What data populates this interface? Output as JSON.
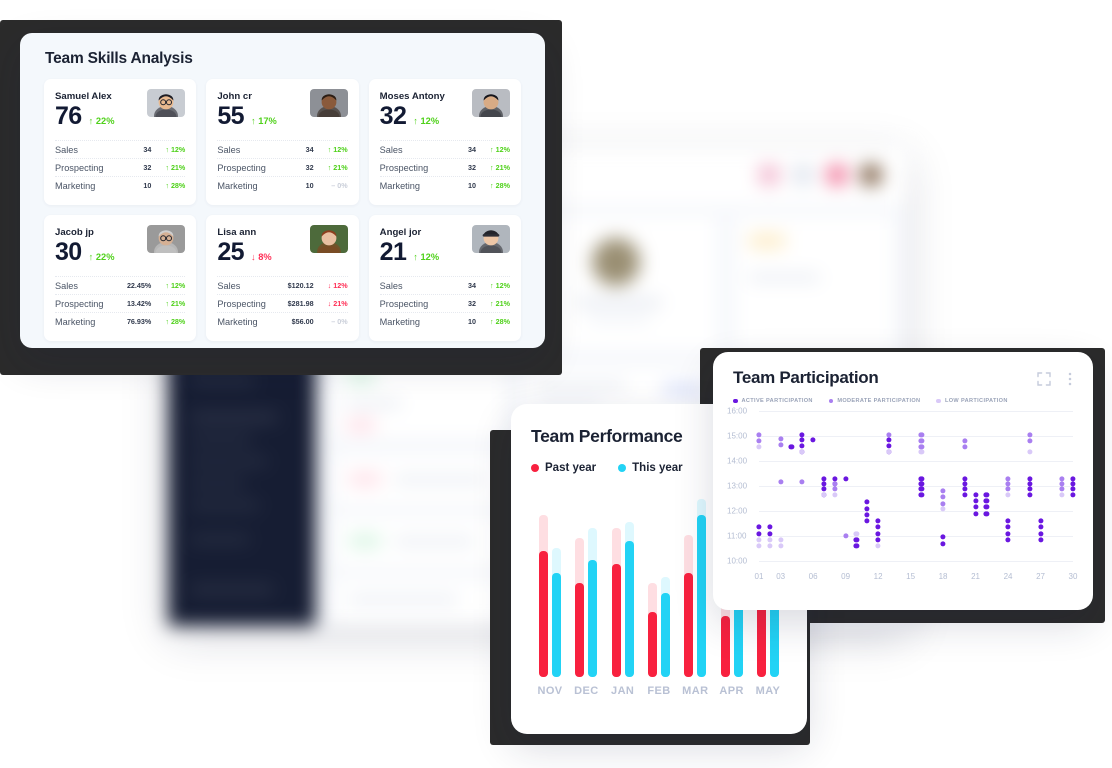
{
  "colors": {
    "frame": "#2b2b2b",
    "up": "#4fd11a",
    "down": "#ff2e55",
    "flat": "#c9ced9",
    "past_year": "#f8213f",
    "this_year": "#22d3f5",
    "active": "#6a17e0",
    "moderate": "#a97ff0",
    "low": "#d9c9f8",
    "panel_bg": "#f4f8fc"
  },
  "skills": {
    "title": "Team Skills Analysis",
    "metric_labels": [
      "Sales",
      "Prospecting",
      "Marketing"
    ],
    "cards": [
      {
        "name": "Samuel Alex",
        "score": "76",
        "delta": "22%",
        "dir": "up",
        "rows": [
          {
            "label": "Sales",
            "value": "34",
            "pct": "12%",
            "dir": "up"
          },
          {
            "label": "Prospecting",
            "value": "32",
            "pct": "21%",
            "dir": "up"
          },
          {
            "label": "Marketing",
            "value": "10",
            "pct": "28%",
            "dir": "up"
          }
        ]
      },
      {
        "name": "John cr",
        "score": "55",
        "delta": "17%",
        "dir": "up",
        "rows": [
          {
            "label": "Sales",
            "value": "34",
            "pct": "12%",
            "dir": "up"
          },
          {
            "label": "Prospecting",
            "value": "32",
            "pct": "21%",
            "dir": "up"
          },
          {
            "label": "Marketing",
            "value": "10",
            "pct": "0%",
            "dir": "flat"
          }
        ]
      },
      {
        "name": "Moses Antony",
        "score": "32",
        "delta": "12%",
        "dir": "up",
        "rows": [
          {
            "label": "Sales",
            "value": "34",
            "pct": "12%",
            "dir": "up"
          },
          {
            "label": "Prospecting",
            "value": "32",
            "pct": "21%",
            "dir": "up"
          },
          {
            "label": "Marketing",
            "value": "10",
            "pct": "28%",
            "dir": "up"
          }
        ]
      },
      {
        "name": "Jacob jp",
        "score": "30",
        "delta": "22%",
        "dir": "up",
        "rows": [
          {
            "label": "Sales",
            "value": "22.45%",
            "pct": "12%",
            "dir": "up"
          },
          {
            "label": "Prospecting",
            "value": "13.42%",
            "pct": "21%",
            "dir": "up"
          },
          {
            "label": "Marketing",
            "value": "76.93%",
            "pct": "28%",
            "dir": "up"
          }
        ]
      },
      {
        "name": "Lisa ann",
        "score": "25",
        "delta": "8%",
        "dir": "down",
        "rows": [
          {
            "label": "Sales",
            "value": "$120.12",
            "pct": "12%",
            "dir": "down"
          },
          {
            "label": "Prospecting",
            "value": "$281.98",
            "pct": "21%",
            "dir": "down"
          },
          {
            "label": "Marketing",
            "value": "$56.00",
            "pct": "0%",
            "dir": "flat"
          }
        ]
      },
      {
        "name": "Angel jor",
        "score": "21",
        "delta": "12%",
        "dir": "up",
        "rows": [
          {
            "label": "Sales",
            "value": "34",
            "pct": "12%",
            "dir": "up"
          },
          {
            "label": "Prospecting",
            "value": "32",
            "pct": "21%",
            "dir": "up"
          },
          {
            "label": "Marketing",
            "value": "10",
            "pct": "28%",
            "dir": "up"
          }
        ]
      }
    ]
  },
  "performance": {
    "title": "Team Performance",
    "legend": [
      {
        "label": "Past year",
        "color": "#f8213f"
      },
      {
        "label": "This year",
        "color": "#22d3f5"
      }
    ]
  },
  "participation": {
    "title": "Team Participation",
    "icons": [
      "expand-icon",
      "more-vertical-icon"
    ],
    "legend": [
      {
        "label": "ACTIVE PARTICIPATION",
        "color": "#6a17e0"
      },
      {
        "label": "MODERATE PARTICIPATION",
        "color": "#a97ff0"
      },
      {
        "label": "LOW PARTICIPATION",
        "color": "#d9c9f8"
      }
    ]
  },
  "chart_data": [
    {
      "type": "bar",
      "title": "Team Performance",
      "categories": [
        "NOV",
        "DEC",
        "JAN",
        "FEB",
        "MAR",
        "APR",
        "MAY"
      ],
      "series": [
        {
          "name": "Past year",
          "color": "#f8213f",
          "values": [
            78,
            58,
            70,
            40,
            64,
            38,
            100
          ],
          "track": [
            100,
            86,
            92,
            58,
            88,
            58,
            100
          ]
        },
        {
          "name": "This year",
          "color": "#22d3f5",
          "values": [
            64,
            72,
            84,
            52,
            100,
            84,
            96
          ],
          "track": [
            80,
            92,
            96,
            62,
            110,
            84,
            96
          ]
        }
      ],
      "xlabel": "",
      "ylabel": "",
      "ylim": [
        0,
        110
      ],
      "grid": false,
      "legend_position": "top-left"
    },
    {
      "type": "scatter",
      "title": "Team Participation",
      "xlabel": "",
      "ylabel": "",
      "y_ticks": [
        "10:00",
        "11:00",
        "12:00",
        "13:00",
        "14:00",
        "15:00",
        "16:00"
      ],
      "x_ticks": [
        "01",
        "03",
        "06",
        "09",
        "12",
        "15",
        "18",
        "21",
        "24",
        "27",
        "30"
      ],
      "ylim": [
        10,
        16
      ],
      "grid": true,
      "legend_position": "top-left",
      "series": [
        {
          "name": "ACTIVE PARTICIPATION",
          "color": "#6a17e0",
          "points": [
            [
              1,
              11.35
            ],
            [
              1,
              11.1
            ],
            [
              2,
              11.35
            ],
            [
              2,
              11.1
            ],
            [
              4,
              14.55
            ],
            [
              5,
              15.05
            ],
            [
              5,
              14.85
            ],
            [
              5,
              14.6
            ],
            [
              5,
              14.35
            ],
            [
              6,
              14.85
            ],
            [
              7,
              13.3
            ],
            [
              7,
              13.1
            ],
            [
              7,
              12.9
            ],
            [
              7,
              12.65
            ],
            [
              8,
              13.3
            ],
            [
              8,
              13.1
            ],
            [
              9,
              13.3
            ],
            [
              10,
              10.85
            ],
            [
              10,
              10.6
            ],
            [
              11,
              12.35
            ],
            [
              11,
              12.1
            ],
            [
              11,
              11.85
            ],
            [
              11,
              11.6
            ],
            [
              12,
              11.6
            ],
            [
              12,
              11.35
            ],
            [
              12,
              11.1
            ],
            [
              12,
              10.85
            ],
            [
              13,
              14.85
            ],
            [
              13,
              14.6
            ],
            [
              13,
              14.35
            ],
            [
              16,
              13.3
            ],
            [
              16,
              13.1
            ],
            [
              16,
              12.9
            ],
            [
              16,
              12.65
            ],
            [
              18,
              10.95
            ],
            [
              18,
              10.7
            ],
            [
              20,
              13.3
            ],
            [
              20,
              13.1
            ],
            [
              20,
              12.9
            ],
            [
              20,
              12.65
            ],
            [
              21,
              12.65
            ],
            [
              21,
              12.4
            ],
            [
              21,
              12.15
            ],
            [
              21,
              11.9
            ],
            [
              22,
              12.65
            ],
            [
              22,
              12.4
            ],
            [
              22,
              12.15
            ],
            [
              22,
              11.9
            ],
            [
              24,
              11.6
            ],
            [
              24,
              11.35
            ],
            [
              24,
              11.1
            ],
            [
              24,
              10.85
            ],
            [
              26,
              13.3
            ],
            [
              26,
              13.1
            ],
            [
              26,
              12.9
            ],
            [
              26,
              12.65
            ],
            [
              27,
              11.6
            ],
            [
              27,
              11.35
            ],
            [
              27,
              11.1
            ],
            [
              27,
              10.85
            ],
            [
              30,
              13.3
            ],
            [
              30,
              13.1
            ],
            [
              30,
              12.9
            ],
            [
              30,
              12.65
            ]
          ]
        },
        {
          "name": "MODERATE PARTICIPATION",
          "color": "#a97ff0",
          "points": [
            [
              1,
              15.05
            ],
            [
              1,
              14.8
            ],
            [
              3,
              14.9
            ],
            [
              3,
              14.65
            ],
            [
              3,
              13.15
            ],
            [
              5,
              13.15
            ],
            [
              8,
              13.1
            ],
            [
              8,
              12.9
            ],
            [
              9,
              11.0
            ],
            [
              13,
              15.05
            ],
            [
              16,
              15.05
            ],
            [
              16,
              14.8
            ],
            [
              16,
              14.55
            ],
            [
              18,
              12.8
            ],
            [
              18,
              12.55
            ],
            [
              18,
              12.3
            ],
            [
              20,
              14.8
            ],
            [
              20,
              14.55
            ],
            [
              24,
              13.3
            ],
            [
              24,
              13.1
            ],
            [
              24,
              12.9
            ],
            [
              26,
              15.05
            ],
            [
              26,
              14.8
            ],
            [
              29,
              13.3
            ],
            [
              29,
              13.1
            ],
            [
              29,
              12.9
            ]
          ]
        },
        {
          "name": "LOW PARTICIPATION",
          "color": "#d9c9f8",
          "points": [
            [
              1,
              14.55
            ],
            [
              1,
              10.85
            ],
            [
              1,
              10.6
            ],
            [
              2,
              10.85
            ],
            [
              2,
              10.6
            ],
            [
              3,
              10.85
            ],
            [
              3,
              10.6
            ],
            [
              5,
              14.35
            ],
            [
              7,
              12.65
            ],
            [
              8,
              12.65
            ],
            [
              10,
              11.1
            ],
            [
              12,
              10.6
            ],
            [
              13,
              14.35
            ],
            [
              16,
              14.35
            ],
            [
              18,
              12.1
            ],
            [
              24,
              12.65
            ],
            [
              26,
              14.35
            ],
            [
              29,
              12.65
            ]
          ]
        }
      ]
    }
  ]
}
